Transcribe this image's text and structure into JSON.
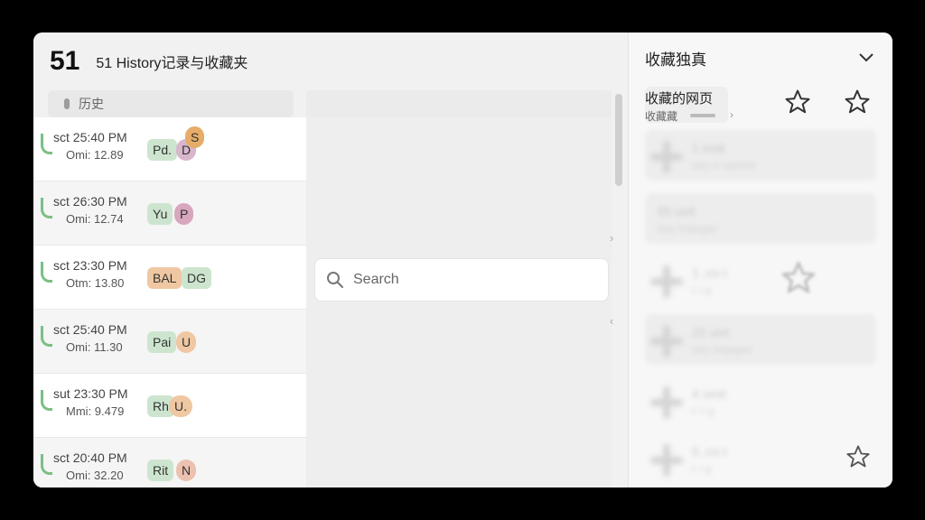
{
  "header": {
    "count": "51",
    "title": "51 History记录与收藏夹"
  },
  "list_header": {
    "label": "历史"
  },
  "history": [
    {
      "time": "sct 25:40 PM",
      "meta": "Omi: 12.89",
      "tags": [
        {
          "text": "Pd.",
          "color": "#cde5cf",
          "shape": "rect"
        },
        {
          "text": "D",
          "color": "#d8b6cc",
          "shape": "round"
        },
        {
          "text": "S",
          "color": "#e6ad6a",
          "shape": "round"
        }
      ]
    },
    {
      "time": "sct 26:30 PM",
      "meta": "Omi: 12.74",
      "tags": [
        {
          "text": "Yu",
          "color": "#cde5cf",
          "shape": "rect"
        },
        {
          "text": "P",
          "color": "#d8a6bf",
          "shape": "round"
        }
      ]
    },
    {
      "time": "sct 23:30 PM",
      "meta": "Otm: 13.80",
      "tags": [
        {
          "text": "BAL",
          "color": "#efc7a2",
          "shape": "rect"
        },
        {
          "text": "DG",
          "color": "#cde5cf",
          "shape": "rect"
        }
      ]
    },
    {
      "time": "sct 25:40 PM",
      "meta": "Omi: 11.30",
      "tags": [
        {
          "text": "Pai",
          "color": "#cde5cf",
          "shape": "rect"
        },
        {
          "text": "U",
          "color": "#efc7a2",
          "shape": "round"
        }
      ]
    },
    {
      "time": "sut 23:30 PM",
      "meta": "Mmi: 9.479",
      "tags": [
        {
          "text": "Rh",
          "color": "#cde5cf",
          "shape": "rect"
        },
        {
          "text": "U.",
          "color": "#efc7a2",
          "shape": "round"
        }
      ]
    },
    {
      "time": "sct 20:40 PM",
      "meta": "Omi: 32.20",
      "tags": [
        {
          "text": "Rit",
          "color": "#cde5cf",
          "shape": "rect"
        },
        {
          "text": "N",
          "color": "#ecc1b0",
          "shape": "round"
        }
      ]
    }
  ],
  "search": {
    "placeholder": "Search"
  },
  "favorites": {
    "title": "收藏独真",
    "top_item_title": "收藏的网页",
    "top_item_sub": "收藏藏"
  },
  "blurred_items": [
    {
      "line1": "1 iosit",
      "line2": "lstry iv wyhhHt"
    },
    {
      "line1": "55 uvit",
      "line2": "lstry hrtpegtel"
    },
    {
      "line1": "1 ,co t",
      "line2": "l- i g"
    },
    {
      "line1": "22 uivt",
      "line2": "lstry hrtpegtel"
    },
    {
      "line1": "4 uvst",
      "line2": "l- l- g"
    },
    {
      "line1": "5 ,co t",
      "line2": "l- i g"
    }
  ]
}
